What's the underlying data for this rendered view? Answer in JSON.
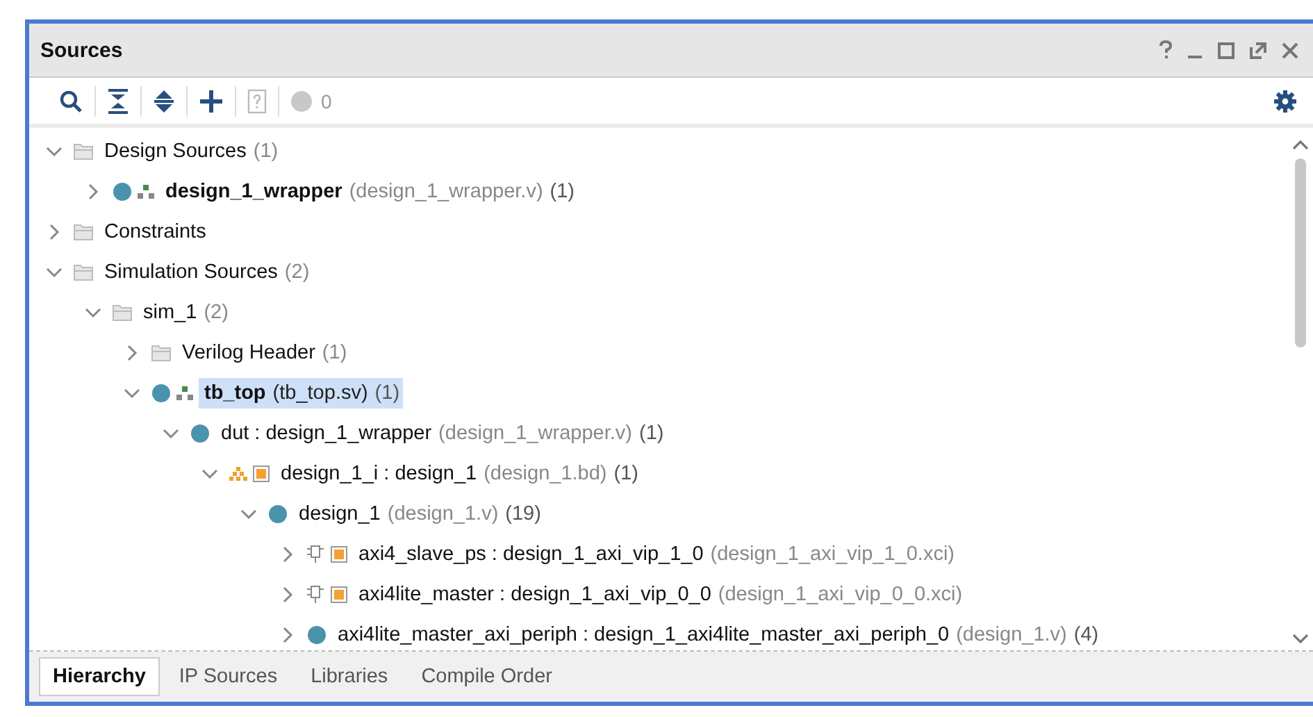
{
  "window": {
    "title": "Sources"
  },
  "toolbar": {
    "error_count": "0"
  },
  "tree": [
    {
      "kind": "folder",
      "name": "Design Sources",
      "count": "(1)",
      "expanded": true,
      "selected": false,
      "children": [
        {
          "kind": "module",
          "icons": [
            {
              "kind": "dot"
            },
            {
              "kind": "hier"
            }
          ],
          "top": true,
          "name": "design_1_wrapper",
          "file": "(design_1_wrapper.v)",
          "count": "(1)",
          "expanded": false,
          "selected": false
        }
      ]
    },
    {
      "kind": "folder",
      "name": "Constraints",
      "expanded": false,
      "selected": false
    },
    {
      "kind": "folder",
      "name": "Simulation Sources",
      "count": "(2)",
      "expanded": true,
      "selected": false,
      "children": [
        {
          "kind": "folder",
          "name": "sim_1",
          "count": "(2)",
          "expanded": true,
          "selected": false,
          "children": [
            {
              "kind": "folder",
              "name": "Verilog Header",
              "count": "(1)",
              "expanded": false,
              "selected": false
            },
            {
              "kind": "module",
              "icons": [
                {
                  "kind": "dot"
                },
                {
                  "kind": "hier"
                }
              ],
              "top": true,
              "name": "tb_top",
              "file": "(tb_top.sv)",
              "count": "(1)",
              "expanded": true,
              "selected": true,
              "children": [
                {
                  "kind": "module",
                  "icons": [
                    {
                      "kind": "dot"
                    }
                  ],
                  "top": false,
                  "name": "dut",
                  "type": ": design_1_wrapper",
                  "file": "(design_1_wrapper.v)",
                  "count": "(1)",
                  "expanded": true,
                  "selected": false,
                  "children": [
                    {
                      "kind": "module",
                      "icons": [
                        {
                          "kind": "bdhier"
                        },
                        {
                          "kind": "ip"
                        }
                      ],
                      "top": false,
                      "name": "design_1_i",
                      "type": ": design_1",
                      "file": "(design_1.bd)",
                      "count": "(1)",
                      "expanded": true,
                      "selected": false,
                      "children": [
                        {
                          "kind": "module",
                          "icons": [
                            {
                              "kind": "dot"
                            }
                          ],
                          "top": false,
                          "name": "design_1",
                          "file": "(design_1.v)",
                          "count": "(19)",
                          "expanded": true,
                          "selected": false,
                          "children": [
                            {
                              "kind": "module",
                              "icons": [
                                {
                                  "kind": "chip"
                                },
                                {
                                  "kind": "ip"
                                }
                              ],
                              "top": false,
                              "name": "axi4_slave_ps",
                              "type": ": design_1_axi_vip_1_0",
                              "file": "(design_1_axi_vip_1_0.xci)",
                              "expanded": false,
                              "selected": false
                            },
                            {
                              "kind": "module",
                              "icons": [
                                {
                                  "kind": "chip"
                                },
                                {
                                  "kind": "ip"
                                }
                              ],
                              "top": false,
                              "name": "axi4lite_master",
                              "type": ": design_1_axi_vip_0_0",
                              "file": "(design_1_axi_vip_0_0.xci)",
                              "expanded": false,
                              "selected": false
                            },
                            {
                              "kind": "module",
                              "icons": [
                                {
                                  "kind": "dot"
                                }
                              ],
                              "top": false,
                              "name": "axi4lite_master_axi_periph",
                              "type": ": design_1_axi4lite_master_axi_periph_0",
                              "file": "(design_1.v)",
                              "count": "(4)",
                              "expanded": false,
                              "selected": false
                            }
                          ]
                        }
                      ]
                    }
                  ]
                }
              ]
            }
          ]
        }
      ]
    }
  ],
  "tabs": [
    {
      "label": "Hierarchy",
      "selected": true
    },
    {
      "label": "IP Sources",
      "selected": false
    },
    {
      "label": "Libraries",
      "selected": false
    },
    {
      "label": "Compile Order",
      "selected": false
    }
  ]
}
